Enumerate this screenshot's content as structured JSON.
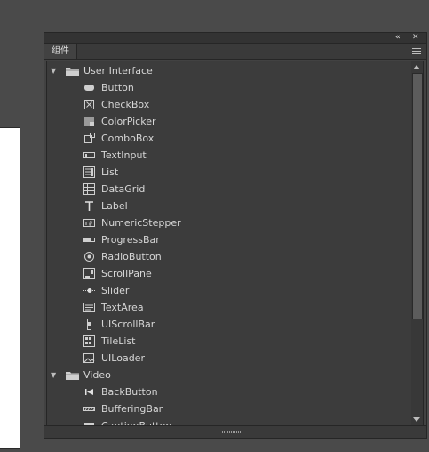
{
  "panel": {
    "tab_label": "组件",
    "collapse_glyph": "«",
    "close_glyph": "✕"
  },
  "tree": [
    {
      "type": "folder",
      "label": "User Interface",
      "expanded": true,
      "icon": "folder-icon"
    },
    {
      "type": "item",
      "label": "Button",
      "icon": "button-component-icon"
    },
    {
      "type": "item",
      "label": "CheckBox",
      "icon": "checkbox-component-icon"
    },
    {
      "type": "item",
      "label": "ColorPicker",
      "icon": "colorpicker-component-icon"
    },
    {
      "type": "item",
      "label": "ComboBox",
      "icon": "combobox-component-icon"
    },
    {
      "type": "item",
      "label": "TextInput",
      "icon": "textinput-component-icon"
    },
    {
      "type": "item",
      "label": "List",
      "icon": "list-component-icon"
    },
    {
      "type": "item",
      "label": "DataGrid",
      "icon": "datagrid-component-icon"
    },
    {
      "type": "item",
      "label": "Label",
      "icon": "label-component-icon"
    },
    {
      "type": "item",
      "label": "NumericStepper",
      "icon": "numericstepper-component-icon"
    },
    {
      "type": "item",
      "label": "ProgressBar",
      "icon": "progressbar-component-icon"
    },
    {
      "type": "item",
      "label": "RadioButton",
      "icon": "radiobutton-component-icon"
    },
    {
      "type": "item",
      "label": "ScrollPane",
      "icon": "scrollpane-component-icon"
    },
    {
      "type": "item",
      "label": "Slider",
      "icon": "slider-component-icon"
    },
    {
      "type": "item",
      "label": "TextArea",
      "icon": "textarea-component-icon"
    },
    {
      "type": "item",
      "label": "UIScrollBar",
      "icon": "uiscrollbar-component-icon"
    },
    {
      "type": "item",
      "label": "TileList",
      "icon": "tilelist-component-icon"
    },
    {
      "type": "item",
      "label": "UILoader",
      "icon": "uiloader-component-icon"
    },
    {
      "type": "folder",
      "label": "Video",
      "expanded": true,
      "icon": "folder-icon"
    },
    {
      "type": "item",
      "label": "BackButton",
      "icon": "backbutton-component-icon"
    },
    {
      "type": "item",
      "label": "BufferingBar",
      "icon": "bufferingbar-component-icon"
    },
    {
      "type": "item",
      "label": "CaptionButton",
      "icon": "captionbutton-component-icon"
    }
  ],
  "colors": {
    "background": "#4a4a4a",
    "panel": "#424242",
    "text": "#d6d6d6"
  }
}
